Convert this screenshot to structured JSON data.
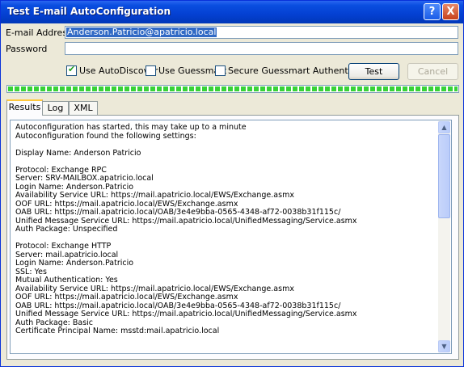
{
  "window": {
    "title": "Test E-mail AutoConfiguration",
    "help_glyph": "?",
    "close_glyph": "X"
  },
  "form": {
    "email_label": "E-mail Address",
    "email_value": "Anderson.Patricio@apatricio.local",
    "password_label": "Password",
    "password_value": ""
  },
  "options": {
    "use_autodiscover": {
      "label": "Use AutoDiscover",
      "checked": true
    },
    "use_guessmart": {
      "label": "Use Guessmart",
      "checked": false
    },
    "secure_guessmart": {
      "label": "Secure Guessmart Authentication",
      "checked": false
    }
  },
  "buttons": {
    "test": "Test",
    "cancel": "Cancel"
  },
  "progress_fraction": 1.0,
  "tabs": [
    {
      "label": "Results",
      "active": true
    },
    {
      "label": "Log",
      "active": false
    },
    {
      "label": "XML",
      "active": false
    }
  ],
  "results_lines": [
    "Autoconfiguration has started, this may take up to a minute",
    "Autoconfiguration found the following settings:",
    "",
    "Display Name: Anderson Patricio",
    "",
    "Protocol: Exchange RPC",
    "Server: SRV-MAILBOX.apatricio.local",
    "Login Name: Anderson.Patricio",
    "Availability Service URL: https://mail.apatricio.local/EWS/Exchange.asmx",
    "OOF URL: https://mail.apatricio.local/EWS/Exchange.asmx",
    "OAB URL: https://mail.apatricio.local/OAB/3e4e9bba-0565-4348-af72-0038b31f115c/",
    "Unified Message Service URL: https://mail.apatricio.local/UnifiedMessaging/Service.asmx",
    "Auth Package: Unspecified",
    "",
    "Protocol: Exchange HTTP",
    "Server: mail.apatricio.local",
    "Login Name: Anderson.Patricio",
    "SSL: Yes",
    "Mutual Authentication: Yes",
    "Availability Service URL: https://mail.apatricio.local/EWS/Exchange.asmx",
    "OOF URL: https://mail.apatricio.local/EWS/Exchange.asmx",
    "OAB URL: https://mail.apatricio.local/OAB/3e4e9bba-0565-4348-af72-0038b31f115c/",
    "Unified Message Service URL: https://mail.apatricio.local/UnifiedMessaging/Service.asmx",
    "Auth Package: Basic",
    "Certificate Principal Name: msstd:mail.apatricio.local"
  ],
  "colors": {
    "titlebar": "#0440D2",
    "progress": "#37D237",
    "selection": "#316AC5"
  }
}
